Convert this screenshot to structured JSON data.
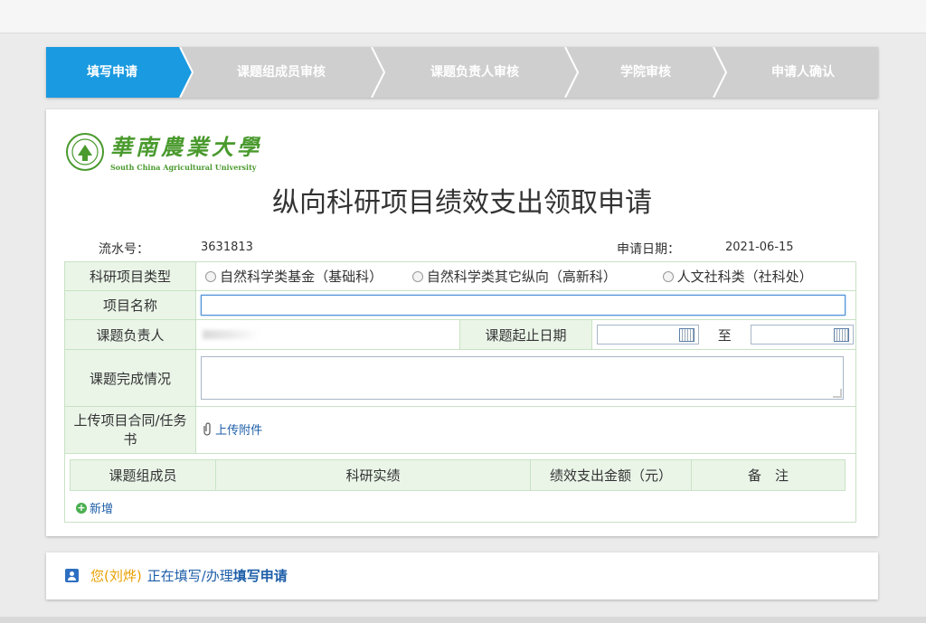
{
  "steps": [
    {
      "label": "填写申请",
      "active": true
    },
    {
      "label": "课题组成员审核",
      "active": false
    },
    {
      "label": "课题负责人审核",
      "active": false
    },
    {
      "label": "学院审核",
      "active": false
    },
    {
      "label": "申请人确认",
      "active": false
    }
  ],
  "logo": {
    "cn": "華南農業大學",
    "en": "South China Agricultural University"
  },
  "title": "纵向科研项目绩效支出领取申请",
  "meta": {
    "serial_label": "流水号：",
    "serial_value": "3631813",
    "date_label": "申请日期：",
    "date_value": "2021-06-15"
  },
  "form": {
    "type_label": "科研项目类型",
    "type_options": [
      "自然科学类基金（基础科）",
      "自然科学类其它纵向（高新科）",
      "人文社科类（社科处）"
    ],
    "name_label": "项目名称",
    "name_value": "",
    "leader_label": "课题负责人",
    "period_label": "课题起止日期",
    "period_to": "至",
    "start_date": "",
    "end_date": "",
    "completion_label": "课题完成情况",
    "completion_value": "",
    "upload_label": "上传项目合同/任务书",
    "upload_link": "上传附件"
  },
  "members": {
    "headers": [
      "课题组成员",
      "科研实绩",
      "绩效支出金额（元）",
      "备　注"
    ],
    "add_label": "新增"
  },
  "footer": {
    "user": "您(刘烨)",
    "text": "正在填写/办理",
    "action": "填写申请"
  },
  "colors": {
    "accent": "#1a9ae0",
    "step_inactive": "#cfcfcf",
    "label_bg": "#eaf5e8",
    "brand_green": "#4a9a2e",
    "user_highlight": "#e8a000"
  }
}
